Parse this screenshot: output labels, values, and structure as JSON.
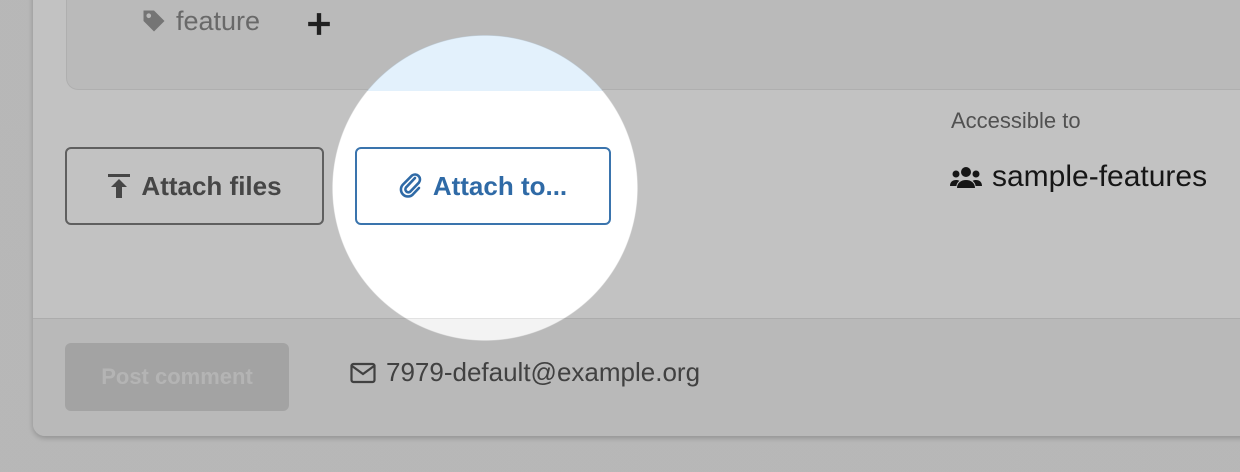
{
  "tags": {
    "items": [
      {
        "label": "feature",
        "icon": "tag-icon"
      }
    ],
    "add_icon": "plus-icon"
  },
  "attachments": {
    "attach_files_label": "Attach files",
    "attach_files_icon": "upload-icon",
    "attach_to_label": "Attach to...",
    "attach_to_icon": "paperclip-icon"
  },
  "access": {
    "label": "Accessible to",
    "value": "sample-features",
    "icon": "users-icon"
  },
  "footer": {
    "post_label": "Post comment",
    "email": "7979-default@example.org",
    "email_icon": "envelope-icon"
  },
  "colors": {
    "accent": "#2f6aa6",
    "spotlight_tint": "#e3f1fc"
  }
}
